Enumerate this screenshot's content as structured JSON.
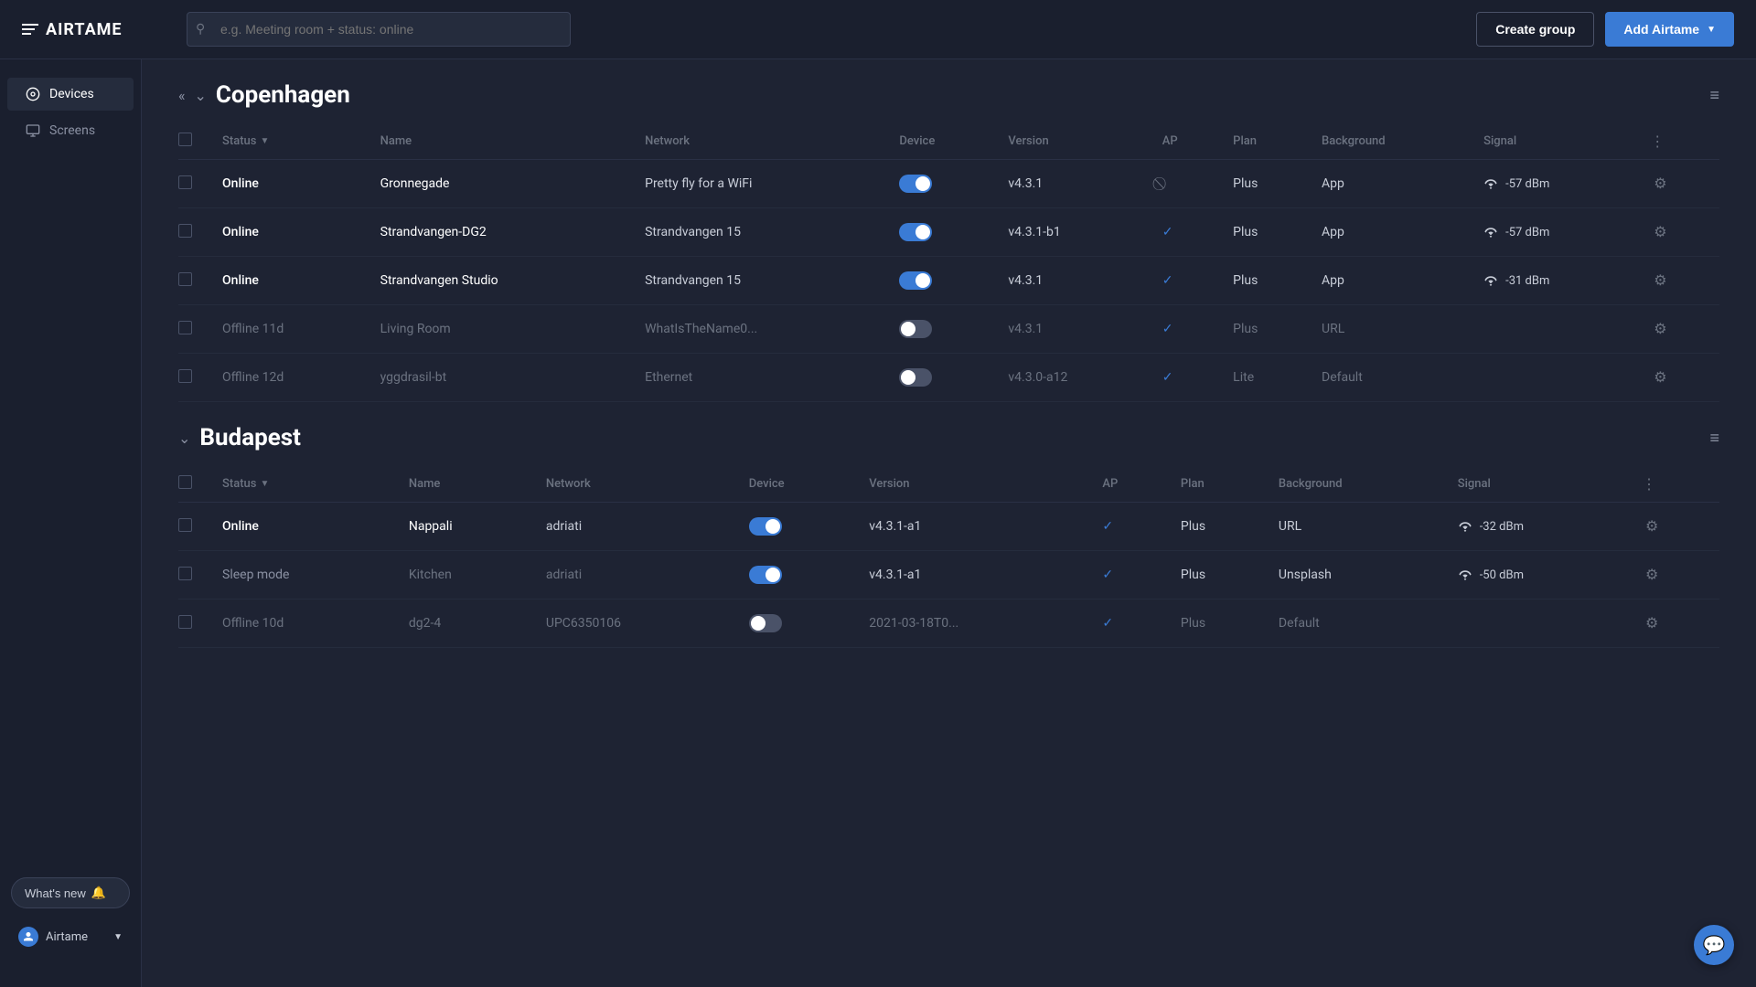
{
  "topbar": {
    "logo_text": "AIRTAME",
    "search_placeholder": "e.g. Meeting room + status: online",
    "create_group_label": "Create group",
    "add_airtame_label": "Add Airtame"
  },
  "sidebar": {
    "items": [
      {
        "id": "devices",
        "label": "Devices",
        "active": true
      },
      {
        "id": "screens",
        "label": "Screens",
        "active": false
      }
    ],
    "whats_new_label": "What's new",
    "user_label": "Airtame"
  },
  "groups": [
    {
      "id": "copenhagen",
      "name": "Copenhagen",
      "columns": {
        "status": "Status",
        "name": "Name",
        "network": "Network",
        "device": "Device",
        "version": "Version",
        "ap": "AP",
        "plan": "Plan",
        "background": "Background",
        "signal": "Signal"
      },
      "devices": [
        {
          "status": "Online",
          "status_class": "online",
          "name": "Gronnegade",
          "network": "Pretty fly for a WiFi",
          "toggle_on": true,
          "version": "v4.3.1",
          "ap": "none",
          "plan": "Plus",
          "background": "App",
          "signal_icon": "wifi",
          "signal_val": "-57 dBm"
        },
        {
          "status": "Online",
          "status_class": "online",
          "name": "Strandvangen-DG2",
          "network": "Strandvangen 15",
          "toggle_on": true,
          "version": "v4.3.1-b1",
          "ap": "check",
          "plan": "Plus",
          "background": "App",
          "signal_icon": "wifi",
          "signal_val": "-57 dBm"
        },
        {
          "status": "Online",
          "status_class": "online",
          "name": "Strandvangen Studio",
          "network": "Strandvangen 15",
          "toggle_on": true,
          "version": "v4.3.1",
          "ap": "check",
          "plan": "Plus",
          "background": "App",
          "signal_icon": "wifi",
          "signal_val": "-31 dBm"
        },
        {
          "status": "Offline 11d",
          "status_class": "offline",
          "name": "Living Room",
          "network": "WhatIsTheName0...",
          "toggle_on": false,
          "version": "v4.3.1",
          "ap": "check",
          "plan": "Plus",
          "background": "URL",
          "signal_icon": "",
          "signal_val": ""
        },
        {
          "status": "Offline 12d",
          "status_class": "offline",
          "name": "yggdrasil-bt",
          "network": "Ethernet",
          "toggle_on": false,
          "version": "v4.3.0-a12",
          "ap": "check",
          "plan": "Lite",
          "background": "Default",
          "signal_icon": "",
          "signal_val": ""
        }
      ]
    },
    {
      "id": "budapest",
      "name": "Budapest",
      "columns": {
        "status": "Status",
        "name": "Name",
        "network": "Network",
        "device": "Device",
        "version": "Version",
        "ap": "AP",
        "plan": "Plan",
        "background": "Background",
        "signal": "Signal"
      },
      "devices": [
        {
          "status": "Online",
          "status_class": "online",
          "name": "Nappali",
          "network": "adriati",
          "toggle_on": true,
          "version": "v4.3.1-a1",
          "ap": "check",
          "plan": "Plus",
          "background": "URL",
          "signal_icon": "wifi",
          "signal_val": "-32 dBm"
        },
        {
          "status": "Sleep mode",
          "status_class": "sleep",
          "name": "Kitchen",
          "network": "adriati",
          "toggle_on": true,
          "version": "v4.3.1-a1",
          "ap": "check",
          "plan": "Plus",
          "background": "Unsplash",
          "signal_icon": "wifi",
          "signal_val": "-50 dBm"
        },
        {
          "status": "Offline 10d",
          "status_class": "offline",
          "name": "dg2-4",
          "network": "UPC6350106",
          "toggle_on": false,
          "version": "2021-03-18T0...",
          "ap": "check",
          "plan": "Plus",
          "background": "Default",
          "signal_icon": "",
          "signal_val": ""
        }
      ]
    }
  ]
}
